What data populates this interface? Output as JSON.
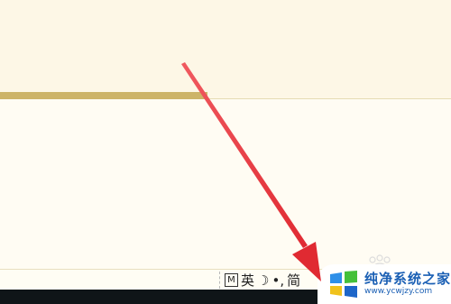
{
  "ime_bar": {
    "mode_label": "M",
    "language": "英",
    "width_mode": "☽",
    "punctuation": "•,",
    "script": "简"
  },
  "watermark": {
    "title": "纯净系统之家",
    "url": "www.ycwjzy.com"
  },
  "colors": {
    "tab_underline": "#cdb468",
    "taskbar": "#0f1518",
    "arrow": "#e8333b",
    "watermark_blue": "#1a5fb4"
  }
}
